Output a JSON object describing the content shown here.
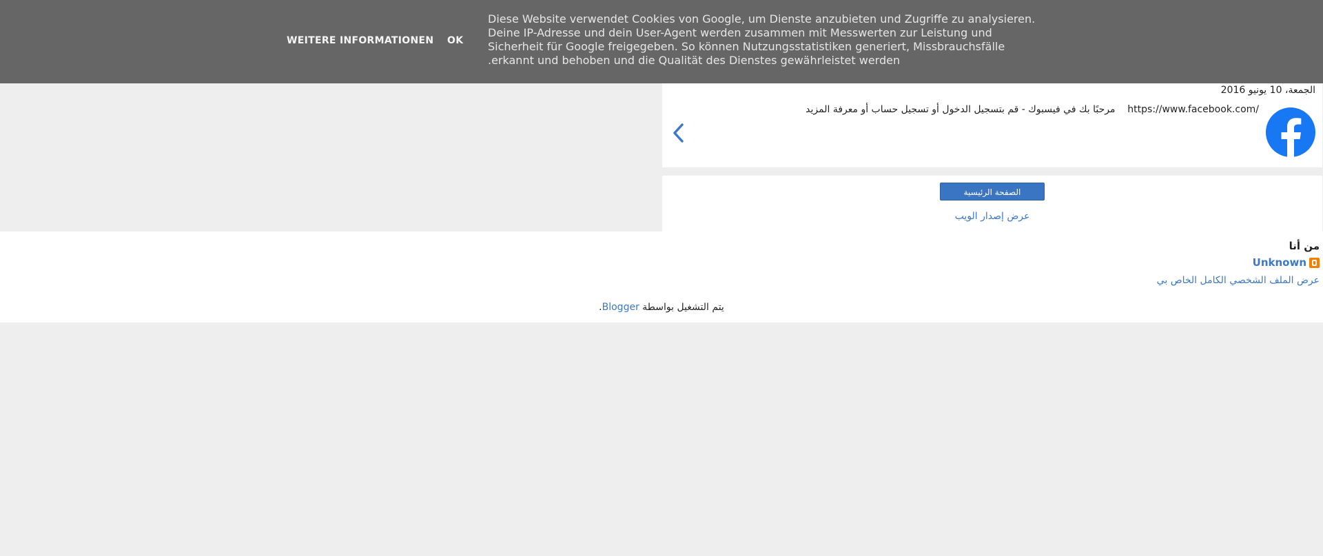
{
  "cookie_bar": {
    "text_lines": [
      "Diese Website verwendet Cookies von Google, um Dienste anzubieten und Zugriffe zu analysieren.",
      "Deine IP-Adresse und dein User-Agent werden zusammen mit Messwerten zur Leistung und",
      "Sicherheit für Google freigegeben. So können Nutzungsstatistiken generiert, Missbrauchsfälle",
      ".erkannt und behoben und die Qualität des Dienstes gewährleistet werden"
    ],
    "ok_label": "OK",
    "more_info_label": "WEITERE INFORMATIONEN"
  },
  "post": {
    "date": "الجمعة، 10 يونيو 2016",
    "text": "مرحبًا بك في فيسبوك - قم بتسجيل الدخول أو تسجيل حساب أو معرفة المزيد",
    "url": "https://www.facebook.com/",
    "logo_icon": "facebook-logo-icon",
    "prev_icon": "chevron-left-icon"
  },
  "nav": {
    "home_label": "الصفحة الرئيسية",
    "web_version_label": "عرض إصدار الويب"
  },
  "profile": {
    "title": "من أنا",
    "name": "Unknown",
    "full_profile_label": "عرض الملف الشخصي الكامل الخاص بي",
    "icon": "blogger-icon"
  },
  "footer": {
    "powered_by_text": "يتم التشغيل بواسطة",
    "blogger_label": "Blogger",
    "trailing": "."
  },
  "colors": {
    "cookie_bg": "#666666",
    "link": "#3b78c5",
    "button": "#3a75c4",
    "facebook": "#1877f2",
    "page_bg": "#eeeeee"
  }
}
